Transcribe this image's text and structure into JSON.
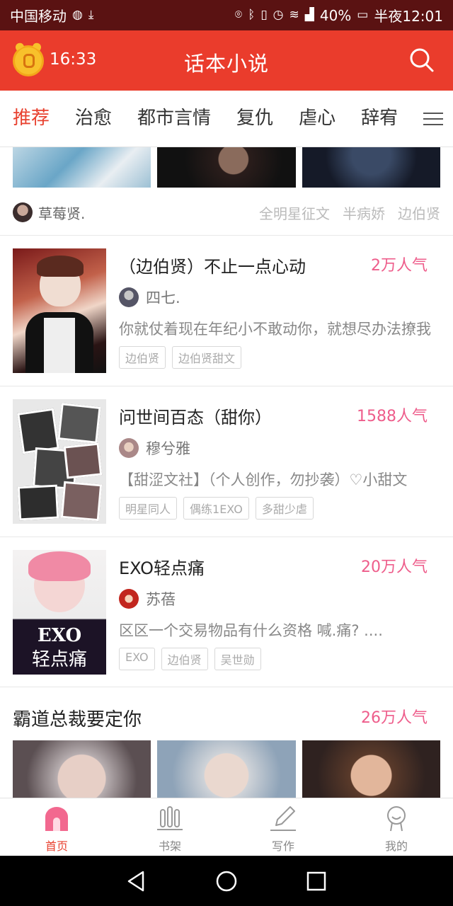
{
  "status_bar": {
    "carrier": "中国移动",
    "battery": "40%",
    "time": "半夜12:01"
  },
  "header": {
    "time": "16:33",
    "title": "话本小说"
  },
  "tabs": [
    "推荐",
    "治愈",
    "都市言情",
    "复仇",
    "虐心",
    "辞宥"
  ],
  "feature_row": {
    "author": "草莓贤.",
    "tags": [
      "全明星征文",
      "半病娇",
      "边伯贤"
    ]
  },
  "books": [
    {
      "title": "（边伯贤）不止一点心动",
      "popularity": "2万人气",
      "author": "四七.",
      "description": "你就仗着现在年纪小不敢动你，就想尽办法撩我",
      "tags": [
        "边伯贤",
        "边伯贤甜文"
      ]
    },
    {
      "title": "问世间百态（甜你）",
      "popularity": "1588人气",
      "author": "穆兮雅",
      "description": "【甜涩文社】（个人创作，勿抄袭）♡小甜文",
      "tags": [
        "明星同人",
        "偶练1EXO",
        "多甜少虐"
      ]
    },
    {
      "title": "EXO轻点痛",
      "popularity": "20万人气",
      "author": "苏蓓",
      "description": "区区一个交易物品有什么资格  喊.痛? ....",
      "tags": [
        "EXO",
        "边伯贤",
        "吴世勋"
      ]
    }
  ],
  "section": {
    "title": "霸道总裁要定你",
    "popularity": "26万人气"
  },
  "bottom_nav": [
    {
      "label": "首页",
      "icon": "home-icon"
    },
    {
      "label": "书架",
      "icon": "bookshelf-icon"
    },
    {
      "label": "写作",
      "icon": "pencil-icon"
    },
    {
      "label": "我的",
      "icon": "profile-icon"
    }
  ],
  "colors": {
    "header": "#ea3c2c",
    "accent": "#e8412f",
    "popularity": "#ee5d8b"
  }
}
